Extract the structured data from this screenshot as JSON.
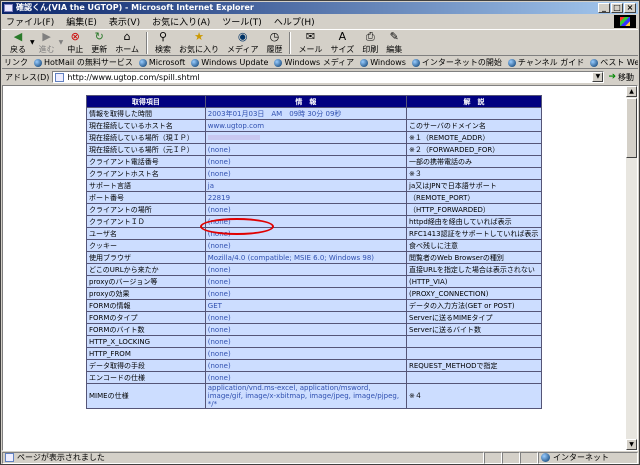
{
  "window": {
    "title": "確認くん(VIA the UGTOP) - Microsoft Internet Explorer"
  },
  "menu": {
    "items": [
      "ファイル(F)",
      "編集(E)",
      "表示(V)",
      "お気に入り(A)",
      "ツール(T)",
      "ヘルプ(H)"
    ]
  },
  "toolbar": {
    "back": "戻る",
    "forward": "進む",
    "stop": "中止",
    "refresh": "更新",
    "home": "ホーム",
    "search": "検索",
    "favorites": "お気に入り",
    "media": "メディア",
    "history": "履歴",
    "mail": "メール",
    "size": "サイズ",
    "print": "印刷",
    "edit": "編集"
  },
  "links": {
    "label": "リンク",
    "items": [
      "HotMail の無料サービス",
      "Microsoft",
      "Windows Update",
      "Windows メディア",
      "Windows",
      "インターネットの開始",
      "チャンネル ガイド",
      "ベスト Web"
    ]
  },
  "address": {
    "label": "アドレス(D)",
    "url": "http://www.ugtop.com/spill.shtml",
    "go_label": "移動"
  },
  "table": {
    "headers": [
      "取得項目",
      "情　報",
      "解　説"
    ],
    "rows": [
      [
        "情報を取得した時間",
        "2003年01月03日　AM　09時 30分 09秒",
        ""
      ],
      [
        "現在接続しているホスト名",
        "www.ugtop.com",
        "このサーバのドメイン名"
      ],
      [
        "現在接続している場所（現ＩＰ）",
        "",
        "※１（REMOTE_ADDR）"
      ],
      [
        "現在接続している場所（元ＩＰ）",
        "(none)",
        "※２（FORWARDED_FOR）"
      ],
      [
        "クライアント電話番号",
        "(none)",
        "一部の携帯電話のみ"
      ],
      [
        "クライアントホスト名",
        "(none)",
        "※３"
      ],
      [
        "サポート言語",
        "ja",
        "ja又はJPNで日本語サポート"
      ],
      [
        "ポート番号",
        "22819",
        "（REMOTE_PORT）"
      ],
      [
        "クライアントの場所",
        "(none)",
        "（HTTP_FORWARDED）"
      ],
      [
        "クライアントＩＤ",
        "(none)",
        "httpd経由を経由していれば表示"
      ],
      [
        "ユーザ名",
        "(none)",
        "RFC1413認証をサポートしていれば表示"
      ],
      [
        "クッキー",
        "(none)",
        "食べ残しに注意"
      ],
      [
        "使用ブラウザ",
        "Mozilla/4.0 (compatible; MSIE 6.0; Windows 98)",
        "閲覧者のWeb Browserの種別"
      ],
      [
        "どこのURLから来たか",
        "(none)",
        "直接URLを指定した場合は表示されない"
      ],
      [
        "proxyのバージョン等",
        "(none)",
        "(HTTP_VIA)"
      ],
      [
        "proxyの効果",
        "(none)",
        "(PROXY_CONNECTION)"
      ],
      [
        "FORMの情報",
        "GET",
        "データの入力方法(GET or POST)"
      ],
      [
        "FORMのタイプ",
        "(none)",
        "Serverに送るMIMEタイプ"
      ],
      [
        "FORMのバイト数",
        "(none)",
        "Serverに送るバイト数"
      ],
      [
        "HTTP_X_LOCKING",
        "(none)",
        ""
      ],
      [
        "HTTP_FROM",
        "(none)",
        ""
      ],
      [
        "データ取得の手段",
        "(none)",
        "REQUEST_METHODで指定"
      ],
      [
        "エンコードの仕様",
        "(none)",
        ""
      ],
      [
        "MIMEの仕様",
        "application/vnd.ms-excel, application/msword, image/gif, image/x-xbitmap, image/jpeg, image/pjpeg, */*",
        "※４"
      ]
    ]
  },
  "status": {
    "text": "ページが表示されました",
    "zone": "インターネット"
  }
}
